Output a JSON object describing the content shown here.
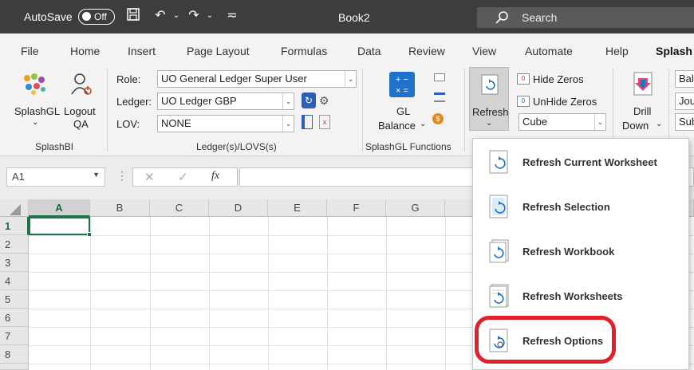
{
  "titlebar": {
    "autosave_label": "AutoSave",
    "autosave_state": "Off",
    "document_title": "Book2",
    "search_placeholder": "Search"
  },
  "tabs": [
    "File",
    "Home",
    "Insert",
    "Page Layout",
    "Formulas",
    "Data",
    "Review",
    "View",
    "Automate",
    "Help",
    "Splash"
  ],
  "active_tab": "Splash",
  "ribbon": {
    "splashbi_group": {
      "label": "SplashBI",
      "splashgl_label": "SplashGL",
      "logout_label": "Logout",
      "logout_sub": "QA"
    },
    "ledger_group": {
      "label": "Ledger(s)/LOVS(s)",
      "role_label": "Role:",
      "role_value": "UO General Ledger Super User",
      "ledger_label": "Ledger:",
      "ledger_value": "UO Ledger GBP",
      "lov_label": "LOV:",
      "lov_value": "NONE"
    },
    "functions_group": {
      "label": "SplashGL Functions",
      "gl_label": "GL",
      "balance_label": "Balance"
    },
    "refresh_group": {
      "refresh_label": "Refresh",
      "hide_zeros": "Hide Zeros",
      "unhide_zeros": "UnHide Zeros",
      "cube_value": "Cube"
    },
    "drill_group": {
      "drill_label": "Drill",
      "down_label": "Down",
      "right_items": [
        "Bal",
        "Jou",
        "Sub"
      ]
    }
  },
  "formula_bar": {
    "name_box": "A1",
    "fx_label": "fx"
  },
  "grid": {
    "columns": [
      "A",
      "B",
      "C",
      "D",
      "E",
      "F",
      "G"
    ],
    "rows": [
      "1",
      "2",
      "3",
      "4",
      "5",
      "6",
      "7",
      "8"
    ],
    "selected_cell": "A1"
  },
  "refresh_menu": {
    "items": [
      {
        "label": "Refresh Current Worksheet"
      },
      {
        "label": "Refresh Selection"
      },
      {
        "label": "Refresh Workbook"
      },
      {
        "label": "Refresh Worksheets"
      },
      {
        "label": "Refresh Options"
      }
    ],
    "highlighted": "Refresh Options"
  },
  "colors": {
    "titlebar_bg": "#3d3d3d",
    "ribbon_bg": "#f3f3f3",
    "excel_green": "#1f7244",
    "highlight_red": "#e0202a"
  }
}
